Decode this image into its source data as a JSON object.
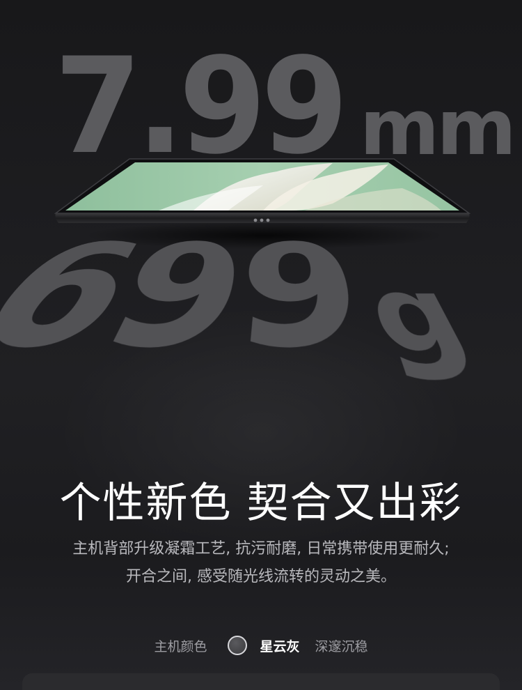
{
  "hero": {
    "thickness_value": "7.99",
    "thickness_unit": "mm",
    "weight_value": "699",
    "weight_unit": "g"
  },
  "headline": "个性新色 契合又出彩",
  "description": {
    "line1": "主机背部升级凝霜工艺, 抗污耐磨, 日常携带使用更耐久;",
    "line2": "开合之间, 感受随光线流转的灵动之美。"
  },
  "color_selector": {
    "label": "主机颜色",
    "options": [
      {
        "label": "星云灰",
        "selected": true,
        "swatch_color": "#4a4a4d"
      },
      {
        "label": "深邃沉稳",
        "selected": false
      }
    ]
  },
  "colors": {
    "background": "#1c1c1f",
    "big_number": "#5b5b5e",
    "headline": "#ffffff",
    "description": "#b9b9bd",
    "screen_green": "#9cc7a8"
  }
}
